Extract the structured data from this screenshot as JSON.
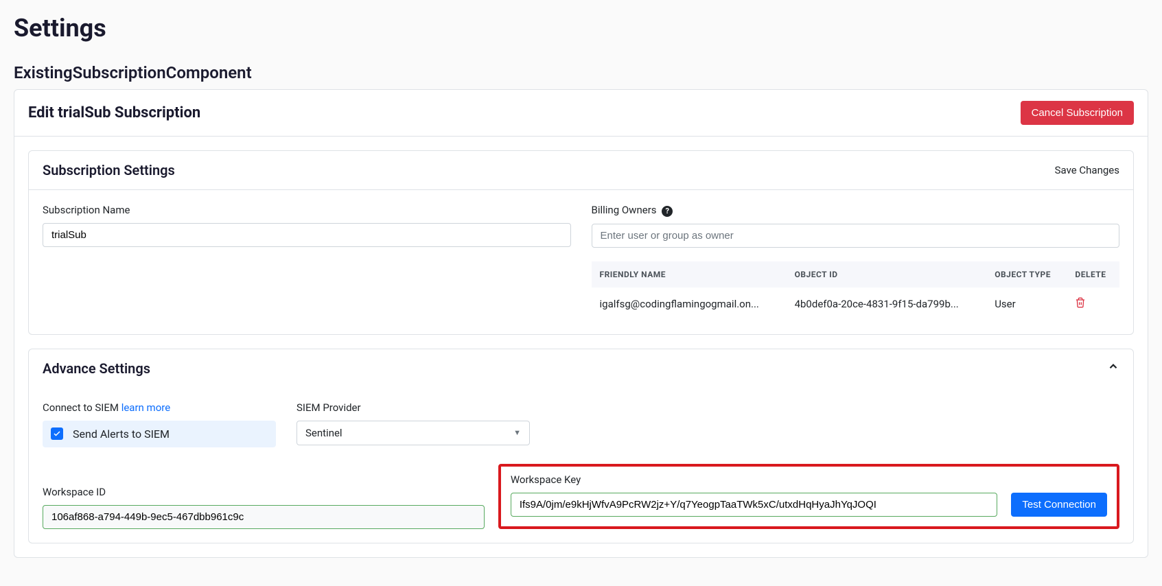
{
  "page": {
    "title": "Settings",
    "component_title": "ExistingSubscriptionComponent",
    "edit_title": "Edit trialSub Subscription",
    "cancel_button": "Cancel Subscription"
  },
  "subscription_settings": {
    "title": "Subscription Settings",
    "save_changes": "Save Changes",
    "subscription_name_label": "Subscription Name",
    "subscription_name_value": "trialSub",
    "billing_owners_label": "Billing Owners",
    "billing_owners_placeholder": "Enter user or group as owner",
    "table": {
      "headers": {
        "friendly_name": "FRIENDLY NAME",
        "object_id": "OBJECT ID",
        "object_type": "OBJECT TYPE",
        "delete": "DELETE"
      },
      "row": {
        "friendly_name": "igalfsg@codingflamingogmail.on...",
        "object_id": "4b0def0a-20ce-4831-9f15-da799b...",
        "object_type": "User"
      }
    }
  },
  "advance": {
    "title": "Advance Settings",
    "connect_label": "Connect to SIEM ",
    "learn_more": "learn more",
    "send_alerts_label": "Send Alerts to SIEM",
    "siem_provider_label": "SIEM Provider",
    "siem_provider_value": "Sentinel",
    "workspace_id_label": "Workspace ID",
    "workspace_id_value": "106af868-a794-449b-9ec5-467dbb961c9c",
    "workspace_key_label": "Workspace Key",
    "workspace_key_value": "Ifs9A/0jm/e9kHjWfvA9PcRW2jz+Y/q7YeogpTaaTWk5xC/utxdHqHyaJhYqJOQI",
    "test_connection": "Test Connection"
  }
}
